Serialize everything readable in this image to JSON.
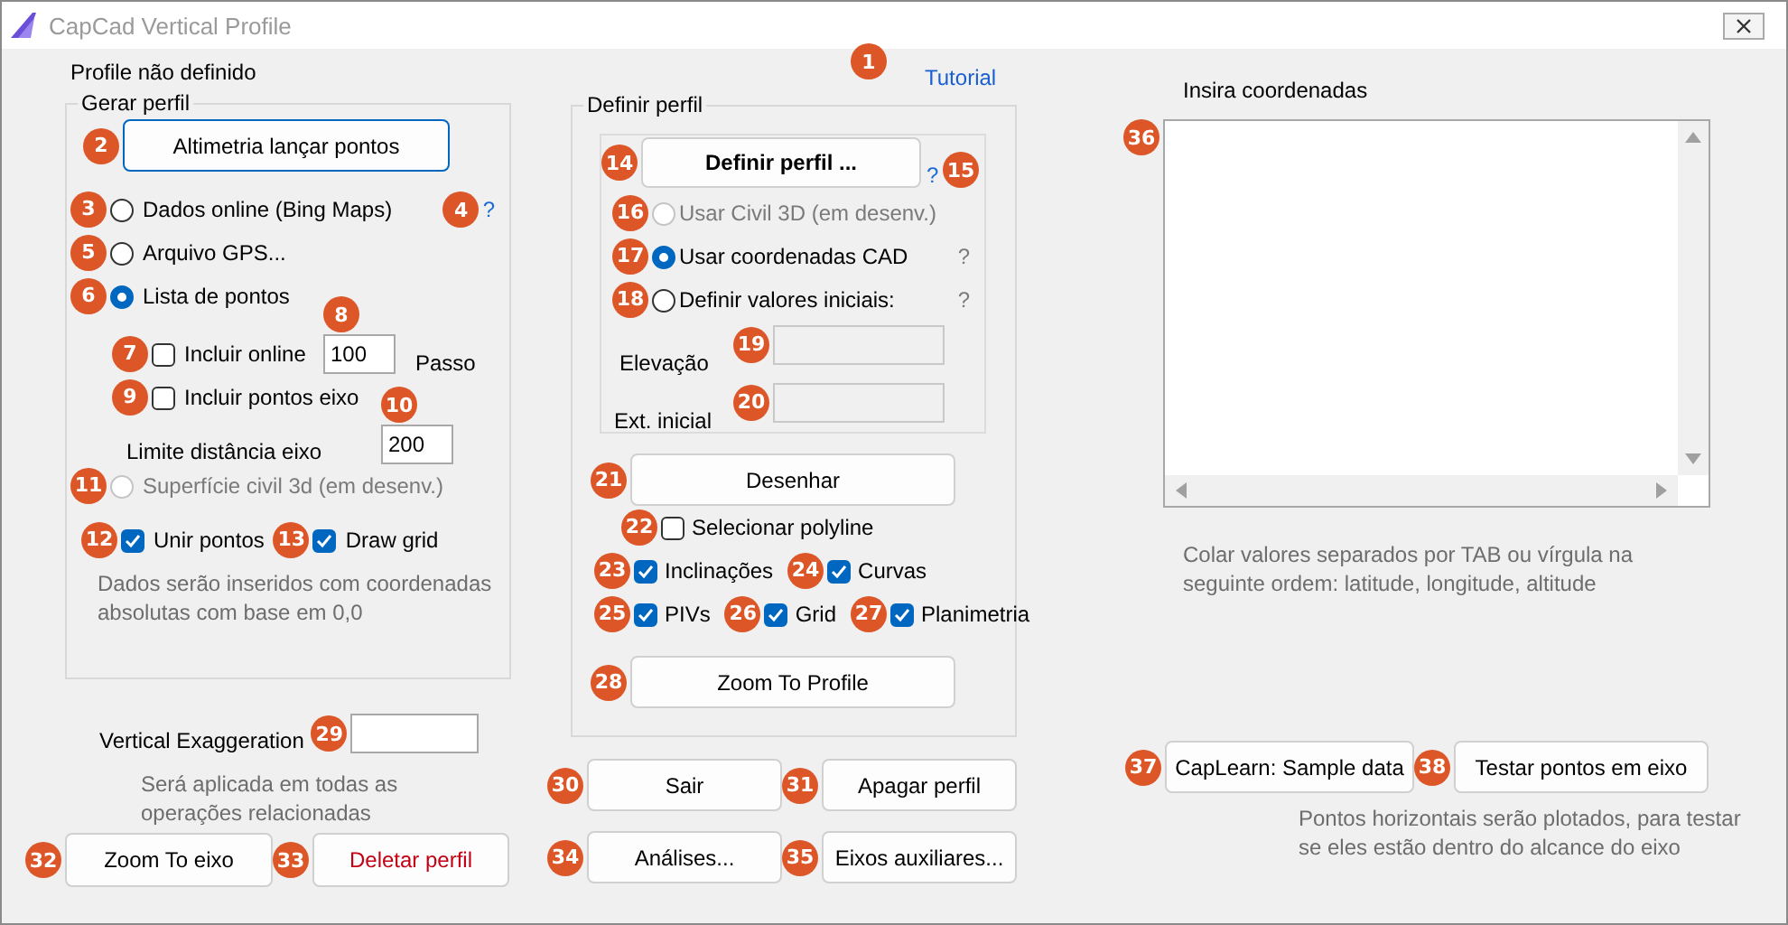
{
  "window": {
    "title": "CapCad Vertical Profile"
  },
  "status": "Profile não definido",
  "tutorial": {
    "label": "Tutorial",
    "badge": "1"
  },
  "gerar_perfil": {
    "title": "Gerar perfil",
    "button": {
      "label": "Altimetria lançar pontos",
      "badge": "2"
    },
    "sources": [
      {
        "label": "Dados online (Bing Maps)",
        "selected": false,
        "badge": "3",
        "help": "?",
        "help_badge": "4"
      },
      {
        "label": "Arquivo GPS...",
        "selected": false,
        "badge": "5"
      },
      {
        "label": "Lista de pontos",
        "selected": true,
        "badge": "6"
      }
    ],
    "incluir_online": {
      "label": "Incluir online",
      "checked": false,
      "badge": "7"
    },
    "passo": {
      "label": "Passo",
      "value": "100",
      "badge": "8"
    },
    "incluir_eixo": {
      "label": "Incluir pontos eixo",
      "checked": false,
      "badge": "9"
    },
    "limite": {
      "label": "Limite distância eixo",
      "value": "200",
      "badge": "10"
    },
    "superficie": {
      "label": "Superfície civil 3d (em desenv.)",
      "selected": false,
      "disabled": true,
      "badge": "11"
    },
    "options": [
      {
        "label": "Unir pontos",
        "checked": true,
        "badge": "12"
      },
      {
        "label": "Draw grid",
        "checked": true,
        "badge": "13"
      }
    ],
    "note": "Dados serão inseridos com coordenadas absolutas com base em 0,0"
  },
  "vertical_exaggeration": {
    "label": "Vertical Exaggeration",
    "badge": "29",
    "note": "Será aplicada em todas as operações relacionadas"
  },
  "left_buttons": [
    {
      "label": "Zoom To eixo",
      "badge": "32",
      "kind": "normal"
    },
    {
      "label": "Deletar perfil",
      "badge": "33",
      "kind": "danger"
    }
  ],
  "definir_perfil": {
    "title": "Definir perfil",
    "button": {
      "label": "Definir perfil  ...",
      "badge": "14"
    },
    "help": {
      "text": "?",
      "badge": "15",
      "disabled": false
    },
    "modes": [
      {
        "label": "Usar Civil 3D (em desenv.)",
        "selected": false,
        "disabled": true,
        "badge": "16"
      },
      {
        "label": "Usar coordenadas CAD",
        "selected": true,
        "disabled": false,
        "badge": "17",
        "help": "?"
      },
      {
        "label": "Definir valores iniciais:",
        "selected": false,
        "disabled": false,
        "badge": "18",
        "help": "?"
      }
    ],
    "fields": [
      {
        "label": "Elevação",
        "badge": "19",
        "disabled": true
      },
      {
        "label": "Ext. inicial",
        "badge": "20",
        "disabled": true
      }
    ],
    "draw_button": {
      "label": "Desenhar",
      "badge": "21"
    },
    "select_polyline": {
      "label": "Selecionar polyline",
      "checked": false,
      "badge": "22"
    },
    "draw_options": [
      [
        {
          "label": "Inclinações",
          "checked": true,
          "badge": "23"
        },
        {
          "label": "Curvas",
          "checked": true,
          "badge": "24"
        }
      ],
      [
        {
          "label": "PIVs",
          "checked": true,
          "badge": "25"
        },
        {
          "label": "Grid",
          "checked": true,
          "badge": "26"
        },
        {
          "label": "Planimetria",
          "checked": true,
          "badge": "27"
        }
      ]
    ],
    "zoom_button": {
      "label": "Zoom To Profile",
      "badge": "28"
    }
  },
  "middle_buttons": [
    {
      "label": "Sair",
      "badge": "30"
    },
    {
      "label": "Apagar perfil",
      "badge": "31"
    },
    {
      "label": "Análises...",
      "badge": "34"
    },
    {
      "label": "Eixos auxiliares...",
      "badge": "35"
    }
  ],
  "coordinates": {
    "label": "Insira coordenadas",
    "badge": "36",
    "note": "Colar valores separados por TAB ou vírgula na seguinte ordem: latitude, longitude, altitude"
  },
  "right_buttons": [
    {
      "label": "CapLearn: Sample data",
      "badge": "37"
    },
    {
      "label": "Testar pontos em eixo",
      "badge": "38"
    }
  ],
  "right_note": "Pontos horizontais serão plotados, para testar se eles estão dentro do alcance do eixo"
}
